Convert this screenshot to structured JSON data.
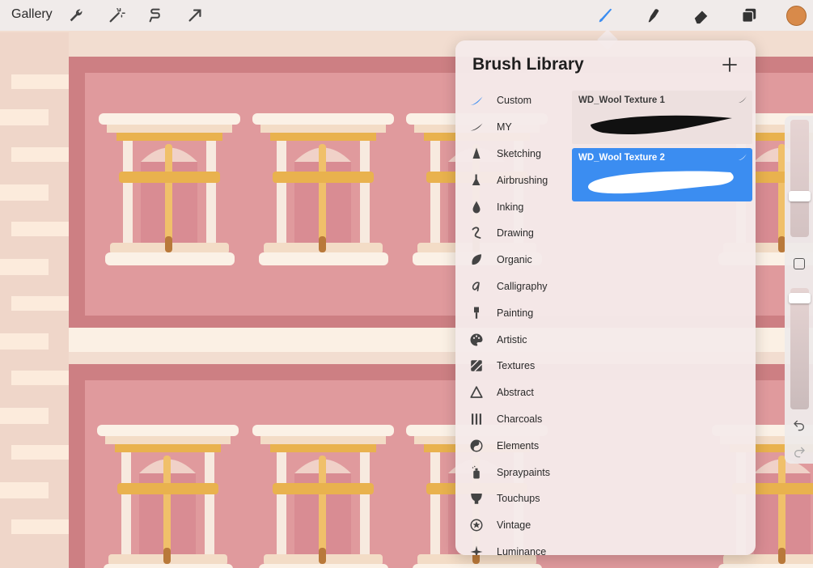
{
  "toolbar": {
    "gallery_label": "Gallery",
    "left_tools": [
      "wrench-icon",
      "magic-wand-icon",
      "selection-icon",
      "transform-arrow-icon"
    ],
    "right_tools": [
      "brush-icon",
      "smudge-icon",
      "eraser-icon",
      "layers-icon"
    ],
    "active_tool": "brush-icon",
    "current_color": "#d88a4a"
  },
  "brush_library": {
    "title": "Brush Library",
    "brush_sets": [
      {
        "label": "Custom",
        "icon": "custom-stroke-icon",
        "selected": true
      },
      {
        "label": "MY",
        "icon": "my-stroke-icon"
      },
      {
        "label": "Sketching",
        "icon": "pencil-tip-icon"
      },
      {
        "label": "Airbrushing",
        "icon": "airbrush-icon"
      },
      {
        "label": "Inking",
        "icon": "ink-drop-icon"
      },
      {
        "label": "Drawing",
        "icon": "squiggle-icon"
      },
      {
        "label": "Organic",
        "icon": "leaf-icon"
      },
      {
        "label": "Calligraphy",
        "icon": "calligraphy-a-icon"
      },
      {
        "label": "Painting",
        "icon": "paint-brush-icon"
      },
      {
        "label": "Artistic",
        "icon": "palette-icon"
      },
      {
        "label": "Textures",
        "icon": "hatch-texture-icon"
      },
      {
        "label": "Abstract",
        "icon": "triangle-icon"
      },
      {
        "label": "Charcoals",
        "icon": "charcoal-sticks-icon"
      },
      {
        "label": "Elements",
        "icon": "yin-yang-icon"
      },
      {
        "label": "Spraypaints",
        "icon": "spray-can-icon"
      },
      {
        "label": "Touchups",
        "icon": "touchup-icon"
      },
      {
        "label": "Vintage",
        "icon": "star-circle-icon"
      },
      {
        "label": "Luminance",
        "icon": "sparkle-icon"
      }
    ],
    "brushes": [
      {
        "name": "WD_Wool Texture 1",
        "selected": false
      },
      {
        "name": "WD_Wool Texture 2",
        "selected": true
      }
    ],
    "accent_color": "#3b8df1"
  }
}
